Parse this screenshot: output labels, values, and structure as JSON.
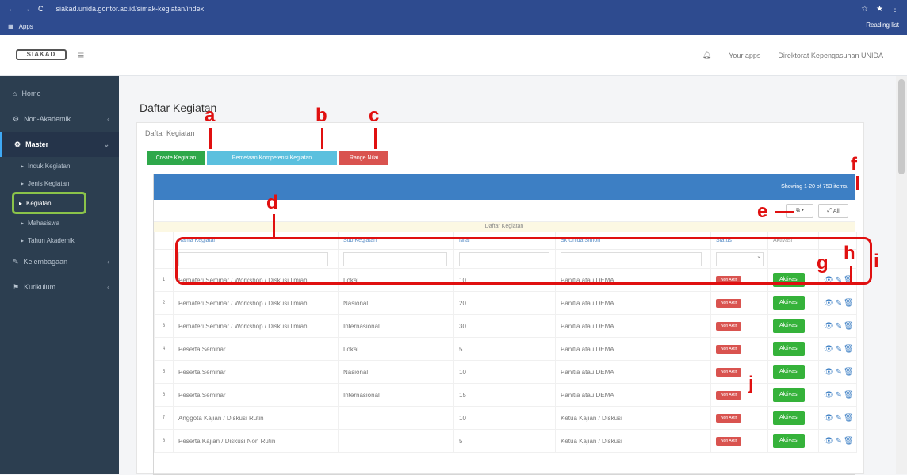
{
  "browser": {
    "url": "siakad.unida.gontor.ac.id/simak-kegiatan/index",
    "bookmark_apps": "Apps",
    "reading_list": "Reading list"
  },
  "topbar": {
    "logo": "SIAKAD",
    "apps_label": "Your apps",
    "user_label": "Direktorat Kepengasuhan UNIDA"
  },
  "sidebar": {
    "items": [
      "Home",
      "Non-Akademik",
      "Master",
      "Kelembagaan",
      "Kurikulum"
    ],
    "subitems": [
      "Induk Kegiatan",
      "Jenis Kegiatan",
      "Kegiatan",
      "Mahasiswa",
      "Tahun Akademik"
    ]
  },
  "page": {
    "title": "Daftar Kegiatan",
    "card_title": "Daftar Kegiatan"
  },
  "buttons": {
    "create": "Create Kegiatan",
    "mapping": "Pemetaan Kompetensi Kegiatan",
    "range": "Range Nilai"
  },
  "grid": {
    "summary": "Showing 1-20 of 753 items.",
    "all_label": "All",
    "caption": "Daftar Kegiatan"
  },
  "columns": [
    "Nama Kegiatan",
    "Sub Kegiatan",
    "Nilai",
    "Sk Unida Simon",
    "Status",
    "Aktivasi"
  ],
  "rows": [
    {
      "no": "1",
      "nama": "Pemateri Seminar / Workshop / Diskusi Ilmiah",
      "sub": "Lokal",
      "nilai": "10",
      "sk": "Panitia atau DEMA",
      "status": "Non Aktif",
      "aktivasi": "Aktivasi"
    },
    {
      "no": "2",
      "nama": "Pemateri Seminar / Workshop / Diskusi Ilmiah",
      "sub": "Nasional",
      "nilai": "20",
      "sk": "Panitia atau DEMA",
      "status": "Non Aktif",
      "aktivasi": "Aktivasi"
    },
    {
      "no": "3",
      "nama": "Pemateri Seminar / Workshop / Diskusi Ilmiah",
      "sub": "Internasional",
      "nilai": "30",
      "sk": "Panitia atau DEMA",
      "status": "Non Aktif",
      "aktivasi": "Aktivasi"
    },
    {
      "no": "4",
      "nama": "Peserta Seminar",
      "sub": "Lokal",
      "nilai": "5",
      "sk": "Panitia atau DEMA",
      "status": "Non Aktif",
      "aktivasi": "Aktivasi"
    },
    {
      "no": "5",
      "nama": "Peserta Seminar",
      "sub": "Nasional",
      "nilai": "10",
      "sk": "Panitia atau DEMA",
      "status": "Non Aktif",
      "aktivasi": "Aktivasi"
    },
    {
      "no": "6",
      "nama": "Peserta Seminar",
      "sub": "Internasional",
      "nilai": "15",
      "sk": "Panitia atau DEMA",
      "status": "Non Aktif",
      "aktivasi": "Aktivasi"
    },
    {
      "no": "7",
      "nama": "Anggota Kajian / Diskusi Rutin",
      "sub": "",
      "nilai": "10",
      "sk": "Ketua Kajian / Diskusi",
      "status": "Non Aktif",
      "aktivasi": "Aktivasi"
    },
    {
      "no": "8",
      "nama": "Peserta Kajian / Diskusi Non Rutin",
      "sub": "",
      "nilai": "5",
      "sk": "Ketua Kajian / Diskusi",
      "status": "Non Aktif",
      "aktivasi": "Aktivasi"
    }
  ],
  "annotations": [
    "a",
    "b",
    "c",
    "d",
    "e",
    "f",
    "g",
    "h",
    "i",
    "j"
  ],
  "colors": {
    "primary": "#3d7fc4",
    "success": "#35b23a",
    "danger": "#d9534f",
    "info": "#5bc0de",
    "sidebar": "#2c3e50",
    "annotation": "#e01010"
  }
}
